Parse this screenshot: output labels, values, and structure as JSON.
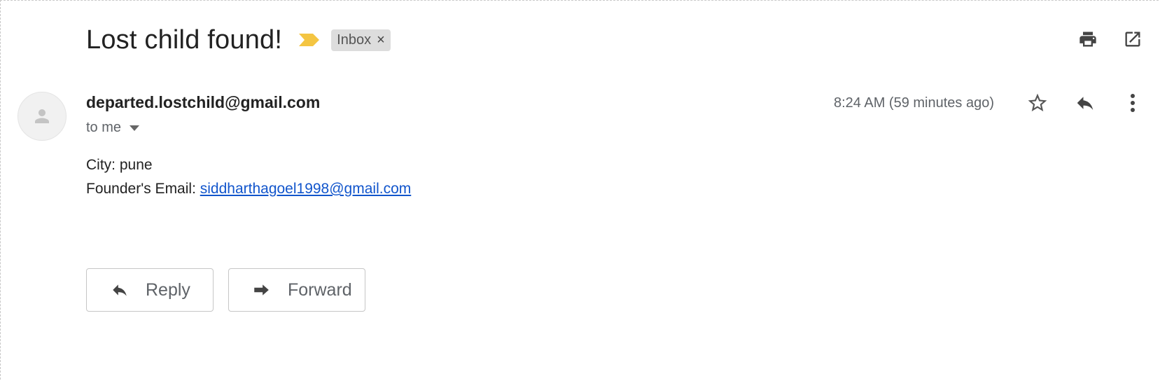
{
  "email": {
    "subject": "Lost child found!",
    "label": "Inbox",
    "label_remove": "×",
    "sender": "departed.lostchild@gmail.com",
    "recipient": "to me",
    "timestamp": "8:24 AM (59 minutes ago)",
    "body": {
      "city_line": "City: pune",
      "founder_prefix": "Founder's Email: ",
      "founder_email": "siddharthagoel1998@gmail.com"
    }
  },
  "actions": {
    "reply_label": "Reply",
    "forward_label": "Forward"
  },
  "icons": {
    "importance": "importance-marker-icon",
    "print": "print-icon",
    "open_new_window": "open-in-new-window-icon",
    "avatar": "person-icon",
    "star": "star-icon",
    "reply": "reply-icon",
    "more": "more-vert-icon",
    "forward": "forward-icon"
  },
  "colors": {
    "importance": "#f4c542",
    "link": "#1155cc",
    "chip_bg": "#dddddd"
  }
}
